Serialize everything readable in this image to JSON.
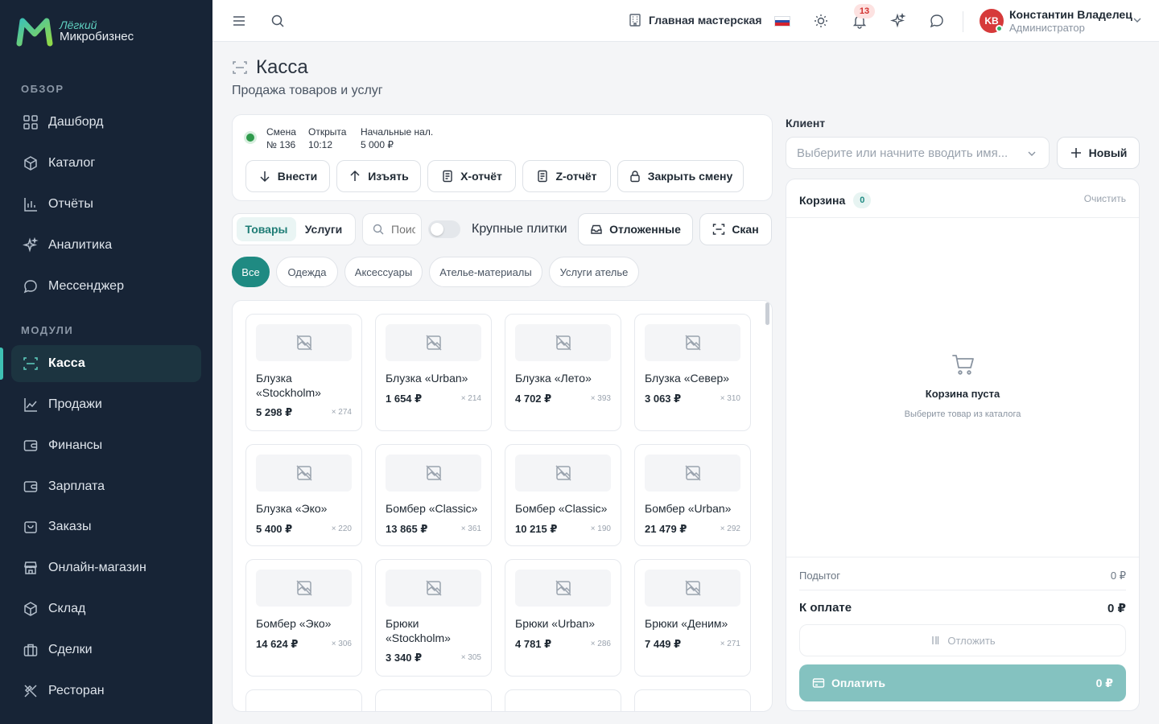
{
  "logo": {
    "top": "Лёгкий",
    "bottom": "Микробизнес"
  },
  "sidebar": {
    "section_overview": "ОБЗОР",
    "section_modules": "МОДУЛИ",
    "items": [
      {
        "label": "Дашборд",
        "icon": "dashboard-icon"
      },
      {
        "label": "Каталог",
        "icon": "catalog-icon"
      },
      {
        "label": "Отчёты",
        "icon": "reports-icon"
      },
      {
        "label": "Аналитика",
        "icon": "sparkle-icon"
      },
      {
        "label": "Мессенджер",
        "icon": "chat-icon"
      },
      {
        "label": "Касса",
        "icon": "scan-icon",
        "active": true
      },
      {
        "label": "Продажи",
        "icon": "trend-icon"
      },
      {
        "label": "Финансы",
        "icon": "wallet-icon"
      },
      {
        "label": "Зарплата",
        "icon": "wallet-icon"
      },
      {
        "label": "Заказы",
        "icon": "bag-icon"
      },
      {
        "label": "Онлайн-магазин",
        "icon": "store-icon"
      },
      {
        "label": "Склад",
        "icon": "box-icon"
      },
      {
        "label": "Сделки",
        "icon": "briefcase-icon"
      },
      {
        "label": "Ресторан",
        "icon": "utensils-icon"
      }
    ]
  },
  "topbar": {
    "branch": "Главная мастерская",
    "notifications_count": "13",
    "user": {
      "initials": "KB",
      "name": "Константин Владелец",
      "role": "Администратор"
    }
  },
  "page": {
    "title": "Касса",
    "subtitle": "Продажа товаров и услуг"
  },
  "shift": {
    "shift_label": "Смена",
    "shift_value": "№ 136",
    "opened_label": "Открыта",
    "opened_value": "10:12",
    "cash_label": "Начальные нал.",
    "cash_value": "5 000 ₽",
    "buttons": {
      "deposit": "Внести",
      "withdraw": "Изъять",
      "x_report": "X-отчёт",
      "z_report": "Z-отчёт",
      "close": "Закрыть смену"
    }
  },
  "toolbar": {
    "tab_goods": "Товары",
    "tab_services": "Услуги",
    "search_placeholder": "Поиск",
    "large_tiles": "Крупные плитки",
    "deferred": "Отложенные",
    "scan": "Скан"
  },
  "categories": [
    "Все",
    "Одежда",
    "Аксессуары",
    "Ателье-материалы",
    "Услуги ателье"
  ],
  "products": [
    {
      "name": "Блузка «Stockholm»",
      "price": "5 298 ₽",
      "stock": "× 274"
    },
    {
      "name": "Блузка «Urban»",
      "price": "1 654 ₽",
      "stock": "× 214"
    },
    {
      "name": "Блузка «Лето»",
      "price": "4 702 ₽",
      "stock": "× 393"
    },
    {
      "name": "Блузка «Север»",
      "price": "3 063 ₽",
      "stock": "× 310"
    },
    {
      "name": "Блузка «Эко»",
      "price": "5 400 ₽",
      "stock": "× 220"
    },
    {
      "name": "Бомбер «Classic»",
      "price": "13 865 ₽",
      "stock": "× 361"
    },
    {
      "name": "Бомбер «Classic»",
      "price": "10 215 ₽",
      "stock": "× 190"
    },
    {
      "name": "Бомбер «Urban»",
      "price": "21 479 ₽",
      "stock": "× 292"
    },
    {
      "name": "Бомбер «Эко»",
      "price": "14 624 ₽",
      "stock": "× 306"
    },
    {
      "name": "Брюки «Stockholm»",
      "price": "3 340 ₽",
      "stock": "× 305"
    },
    {
      "name": "Брюки «Urban»",
      "price": "4 781 ₽",
      "stock": "× 286"
    },
    {
      "name": "Брюки «Деним»",
      "price": "7 449 ₽",
      "stock": "× 271"
    }
  ],
  "client": {
    "label": "Клиент",
    "placeholder": "Выберите или начните вводить имя...",
    "new_button": "Новый"
  },
  "cart": {
    "title": "Корзина",
    "count": "0",
    "clear": "Очистить",
    "empty_title": "Корзина пуста",
    "empty_subtitle": "Выберите товар из каталога",
    "subtotal_label": "Подытог",
    "subtotal_value": "0 ₽",
    "total_label": "К оплате",
    "total_value": "0 ₽",
    "defer_button": "Отложить",
    "pay_button": "Оплатить",
    "pay_amount": "0 ₽"
  },
  "colors": {
    "accent": "#1f8a82",
    "sidebar_bg": "#172436",
    "pay_disabled": "#84c2c0",
    "badge": "#d2312f"
  }
}
